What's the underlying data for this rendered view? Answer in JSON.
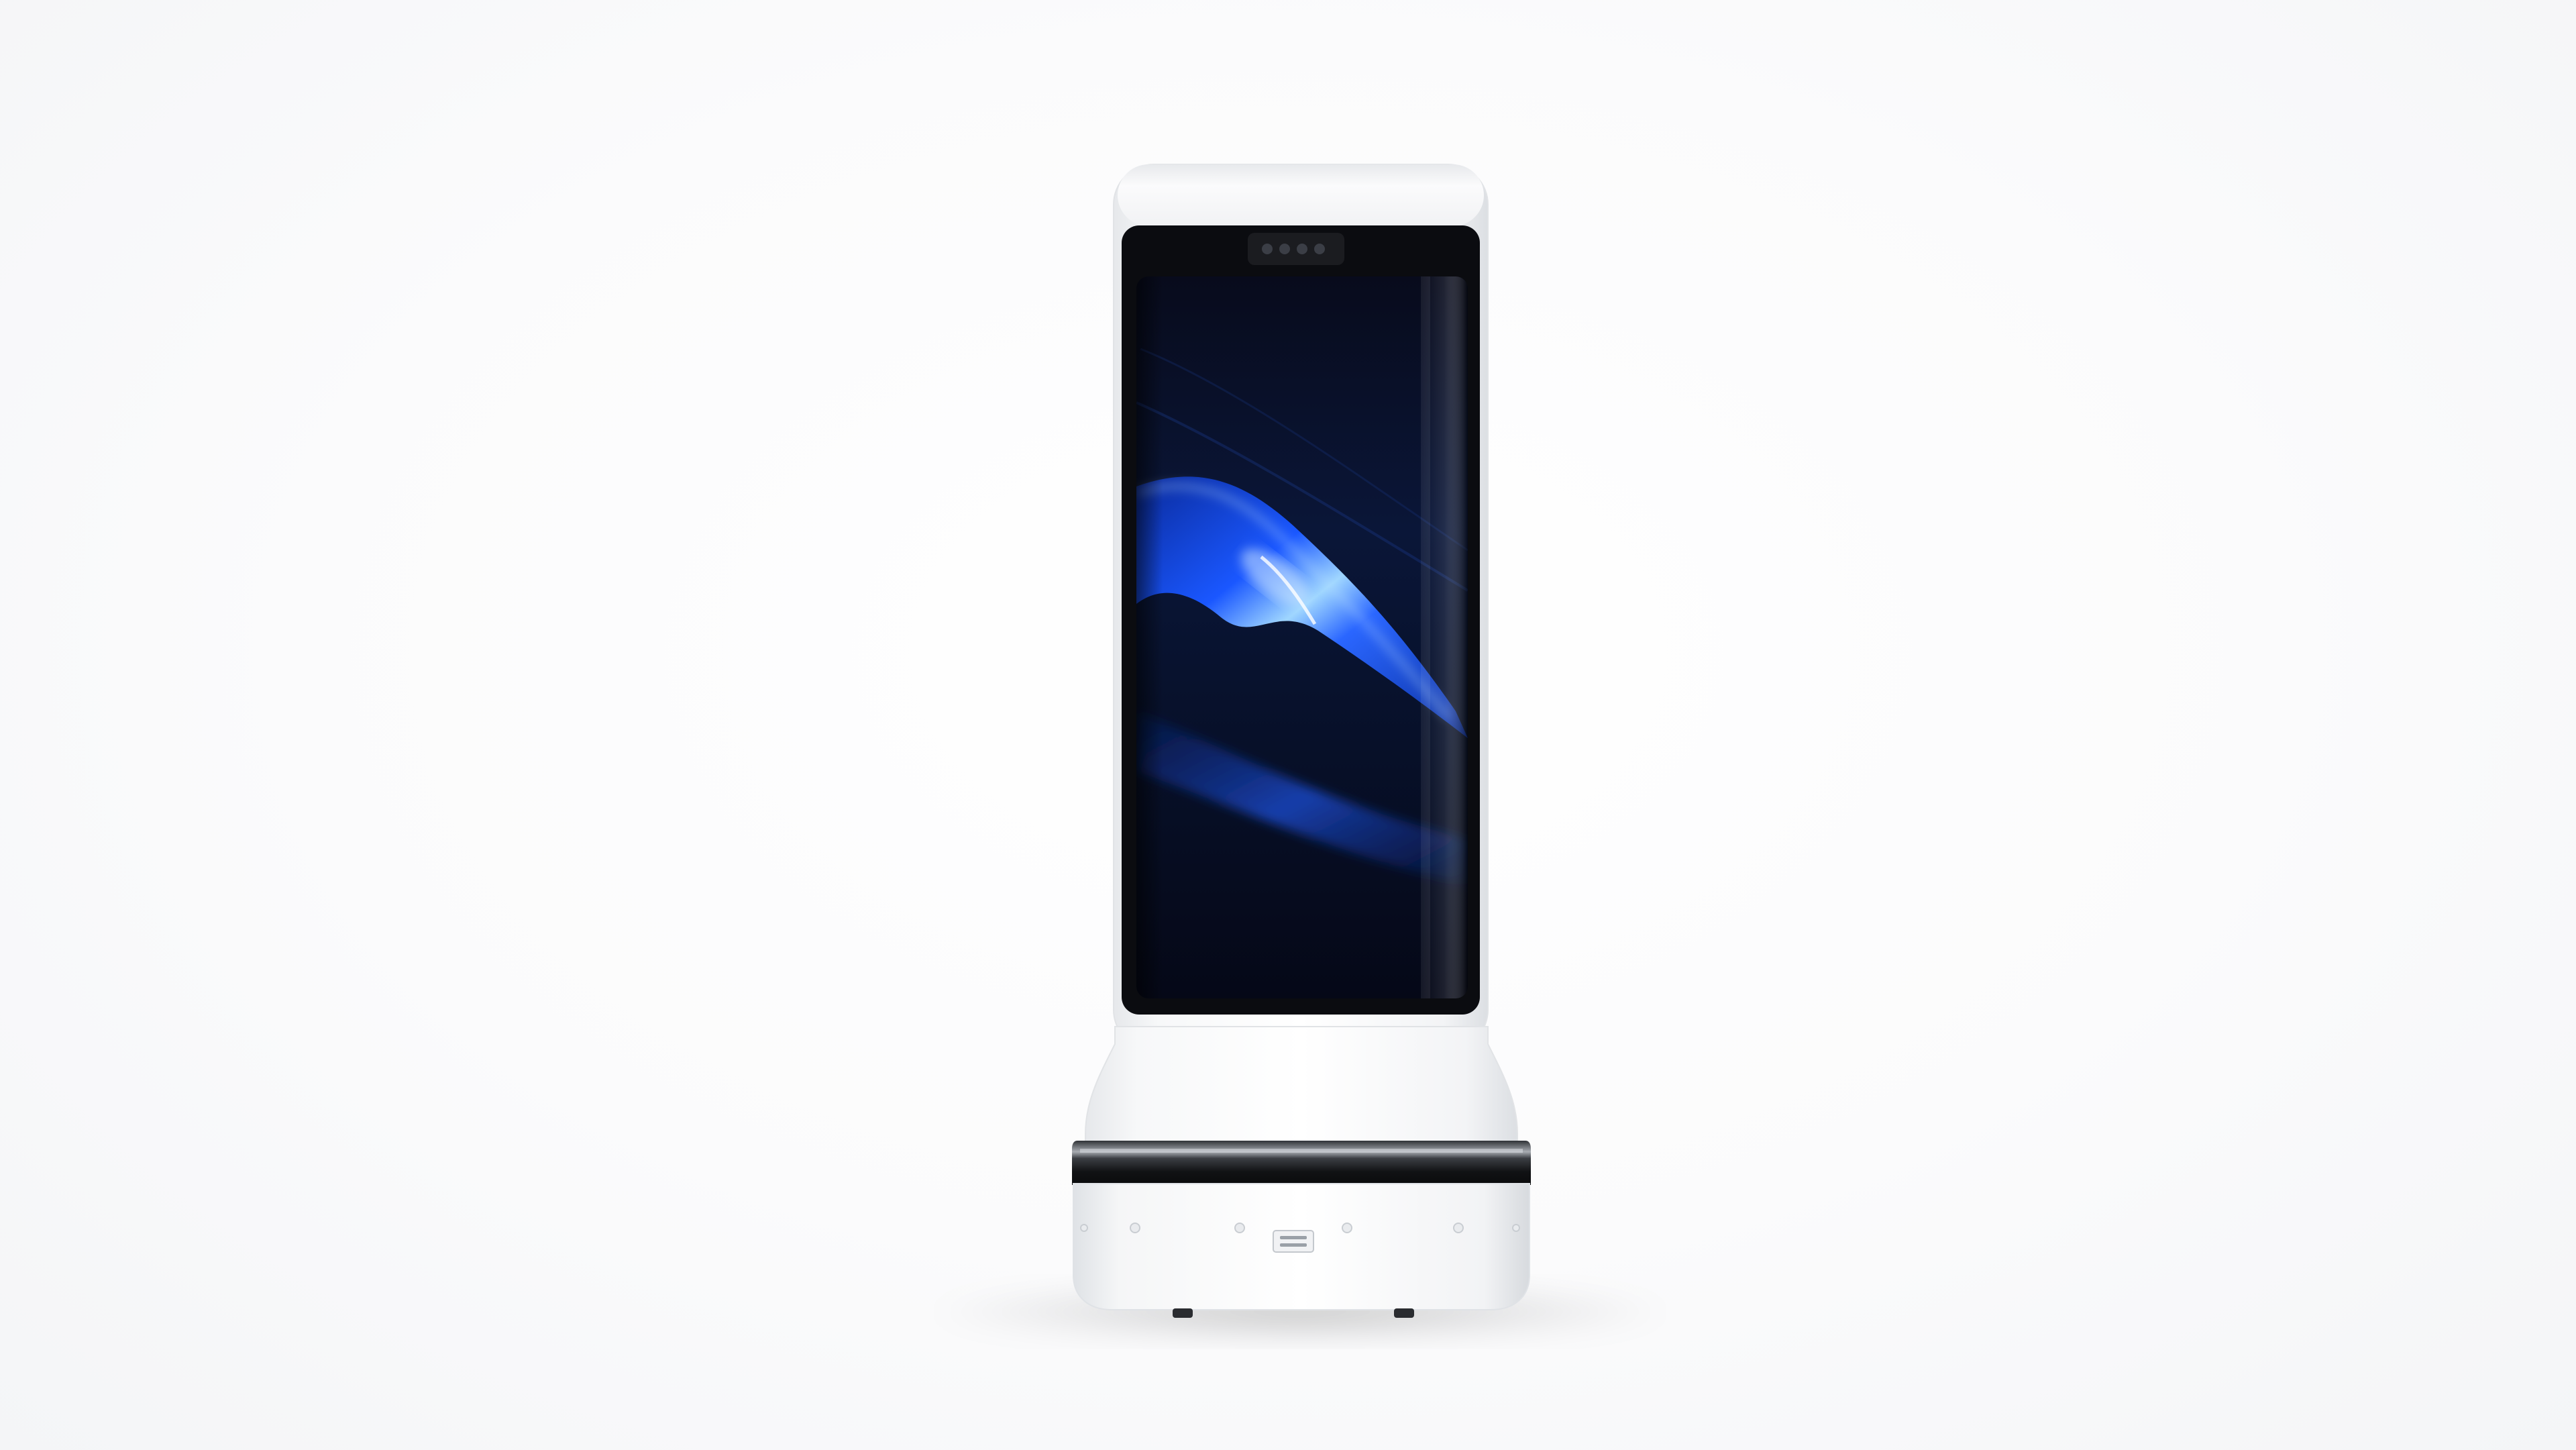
{
  "scene": {
    "subject": "white-service-robot-with-tall-display",
    "background_color": "#ffffff",
    "body_color": "#f6f7f8",
    "screen_colors": {
      "frame": "#0b0c10",
      "dark": "#050817",
      "mid": "#0b1a45",
      "accent": "#1a57ff",
      "highlight": "#9fd6ff"
    },
    "band_colors": {
      "dark": "#0f1012",
      "glass": "#3a3d42"
    }
  }
}
